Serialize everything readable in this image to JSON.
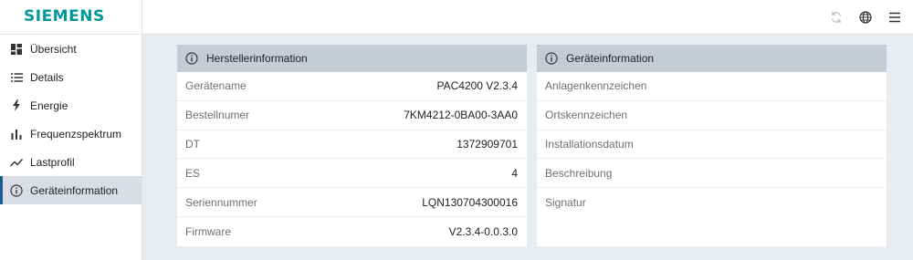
{
  "brand": {
    "name": "SIEMENS",
    "color": "#009999"
  },
  "header": {
    "icons": [
      "refresh-icon",
      "globe-icon",
      "menu-icon"
    ]
  },
  "sidebar": {
    "items": [
      {
        "label": "Übersicht",
        "icon": "dashboard-icon",
        "active": false
      },
      {
        "label": "Details",
        "icon": "list-icon",
        "active": false
      },
      {
        "label": "Energie",
        "icon": "lightning-icon",
        "active": false
      },
      {
        "label": "Frequenzspektrum",
        "icon": "bar-chart-icon",
        "active": false
      },
      {
        "label": "Lastprofil",
        "icon": "line-chart-icon",
        "active": false
      },
      {
        "label": "Geräteinformation",
        "icon": "info-icon",
        "active": true
      }
    ]
  },
  "manufacturer_panel": {
    "title": "Herstellerinformation",
    "rows": [
      {
        "label": "Gerätename",
        "value": "PAC4200 V2.3.4"
      },
      {
        "label": "Bestellnumer",
        "value": "7KM4212-0BA00-3AA0"
      },
      {
        "label": "DT",
        "value": "1372909701"
      },
      {
        "label": "ES",
        "value": "4"
      },
      {
        "label": "Seriennummer",
        "value": "LQN130704300016"
      },
      {
        "label": "Firmware",
        "value": "V2.3.4-0.0.3.0"
      }
    ]
  },
  "device_panel": {
    "title": "Geräteinformation",
    "rows": [
      {
        "label": "Anlagenkennzeichen",
        "value": ""
      },
      {
        "label": "Ortskennzeichen",
        "value": ""
      },
      {
        "label": "Installationsdatum",
        "value": ""
      },
      {
        "label": "Beschreibung",
        "value": ""
      },
      {
        "label": "Signatur",
        "value": ""
      }
    ]
  }
}
